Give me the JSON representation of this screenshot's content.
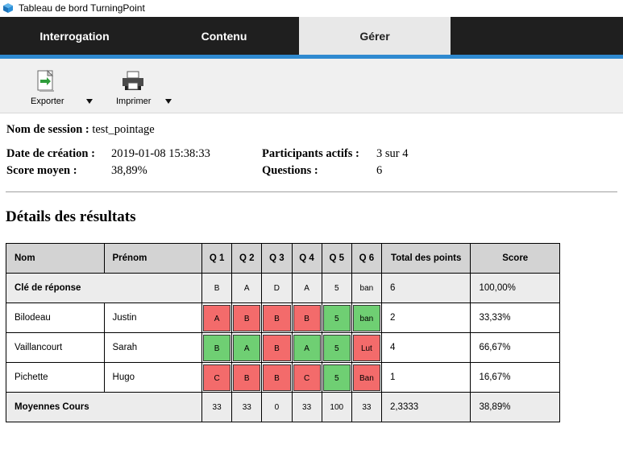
{
  "window": {
    "title": "Tableau de bord TurningPoint"
  },
  "tabs": [
    {
      "label": "Interrogation",
      "active": false
    },
    {
      "label": "Contenu",
      "active": false
    },
    {
      "label": "Gérer",
      "active": true
    }
  ],
  "toolbar": {
    "export_label": "Exporter",
    "print_label": "Imprimer"
  },
  "session": {
    "name_label": "Nom de session :",
    "name_value": "test_pointage",
    "created_label": "Date de création :",
    "created_value": "2019-01-08 15:38:33",
    "avg_label": "Score moyen :",
    "avg_value": "38,89%",
    "participants_label": "Participants actifs :",
    "participants_value": "3 sur 4",
    "questions_label": "Questions :",
    "questions_value": "6"
  },
  "results": {
    "title": "Détails des résultats",
    "headers": {
      "name": "Nom",
      "first": "Prénom",
      "q": [
        "Q 1",
        "Q 2",
        "Q 3",
        "Q 4",
        "Q 5",
        "Q 6"
      ],
      "total": "Total des points",
      "score": "Score"
    },
    "key_row": {
      "label": "Clé de réponse",
      "answers": [
        "B",
        "A",
        "D",
        "A",
        "5",
        "ban"
      ],
      "total": "6",
      "score": "100,00%"
    },
    "rows": [
      {
        "name": "Bilodeau",
        "first": "Justin",
        "answers": [
          "A",
          "B",
          "B",
          "B",
          "5",
          "ban"
        ],
        "correct": [
          false,
          false,
          false,
          false,
          true,
          true
        ],
        "total": "2",
        "score": "33,33%"
      },
      {
        "name": "Vaillancourt",
        "first": "Sarah",
        "answers": [
          "B",
          "A",
          "B",
          "A",
          "5",
          "Lut"
        ],
        "correct": [
          true,
          true,
          false,
          true,
          true,
          false
        ],
        "total": "4",
        "score": "66,67%"
      },
      {
        "name": "Pichette",
        "first": "Hugo",
        "answers": [
          "C",
          "B",
          "B",
          "C",
          "5",
          "Ban"
        ],
        "correct": [
          false,
          false,
          false,
          false,
          true,
          false
        ],
        "total": "1",
        "score": "16,67%"
      }
    ],
    "avg_row": {
      "label": "Moyennes Cours",
      "values": [
        "33",
        "33",
        "0",
        "33",
        "100",
        "33"
      ],
      "total": "2,3333",
      "score": "38,89%"
    }
  },
  "colors": {
    "correct": "#6fcf73",
    "incorrect": "#f36b6b",
    "accent": "#2f8ad0",
    "tabbar": "#1f1f1f"
  },
  "icons": {
    "app": "cube-icon",
    "export": "export-document-icon",
    "print": "printer-icon",
    "dropdown": "caret-down-icon"
  }
}
